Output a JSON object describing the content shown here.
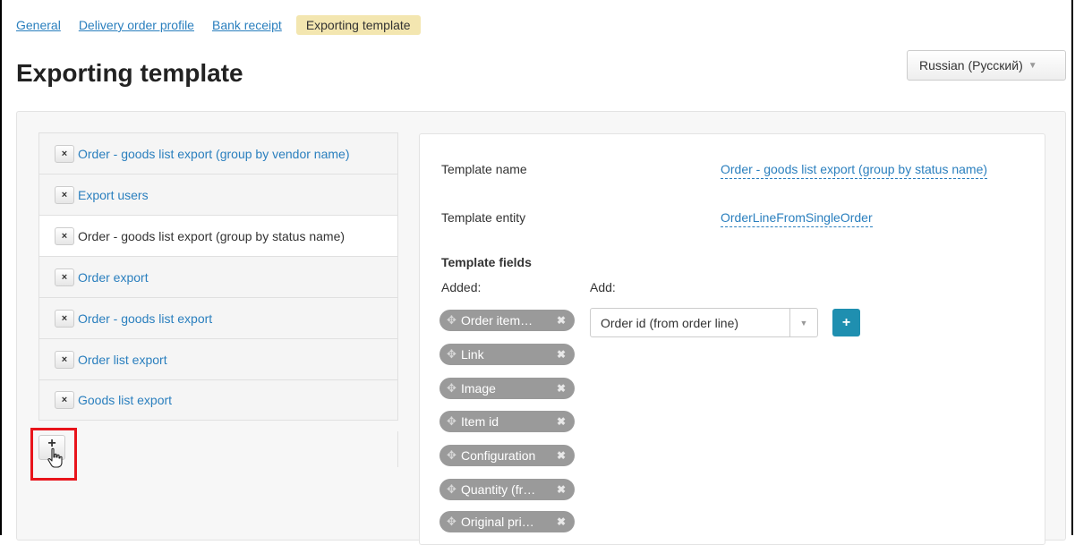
{
  "tabs": [
    {
      "label": "General"
    },
    {
      "label": "Delivery order profile"
    },
    {
      "label": "Bank receipt"
    },
    {
      "label": "Exporting template",
      "active": true
    }
  ],
  "page_title": "Exporting template",
  "language_select": {
    "value": "Russian (Русский)"
  },
  "templates": [
    {
      "label": "Order - goods list export (group by vendor name)"
    },
    {
      "label": "Export users"
    },
    {
      "label": "Order - goods list export (group by status name)",
      "selected": true
    },
    {
      "label": "Order export"
    },
    {
      "label": "Order - goods list export"
    },
    {
      "label": "Order list export"
    },
    {
      "label": "Goods list export"
    }
  ],
  "remove_icon": "×",
  "add_template_button": {
    "label": "+"
  },
  "detail": {
    "template_name_label": "Template name",
    "template_name_value": "Order - goods list export (group by status name)",
    "template_entity_label": "Template entity",
    "template_entity_value": "OrderLineFromSingleOrder",
    "template_fields_heading": "Template fields",
    "added_label": "Added:",
    "add_label": "Add:",
    "added_fields": [
      {
        "label": "Order item…"
      },
      {
        "label": "Link"
      },
      {
        "label": "Image"
      },
      {
        "label": "Item id"
      },
      {
        "label": "Configuration"
      },
      {
        "label": "Quantity (fr…"
      },
      {
        "label": "Original pri…"
      }
    ],
    "add_select_value": "Order id (from order line)",
    "add_button_label": "+"
  },
  "colors": {
    "link": "#2a7fbe",
    "active_tab": "#f3e6b0",
    "chip": "#9a9a9a",
    "add_button": "#1f8fb0",
    "highlight": "#e8141b"
  }
}
